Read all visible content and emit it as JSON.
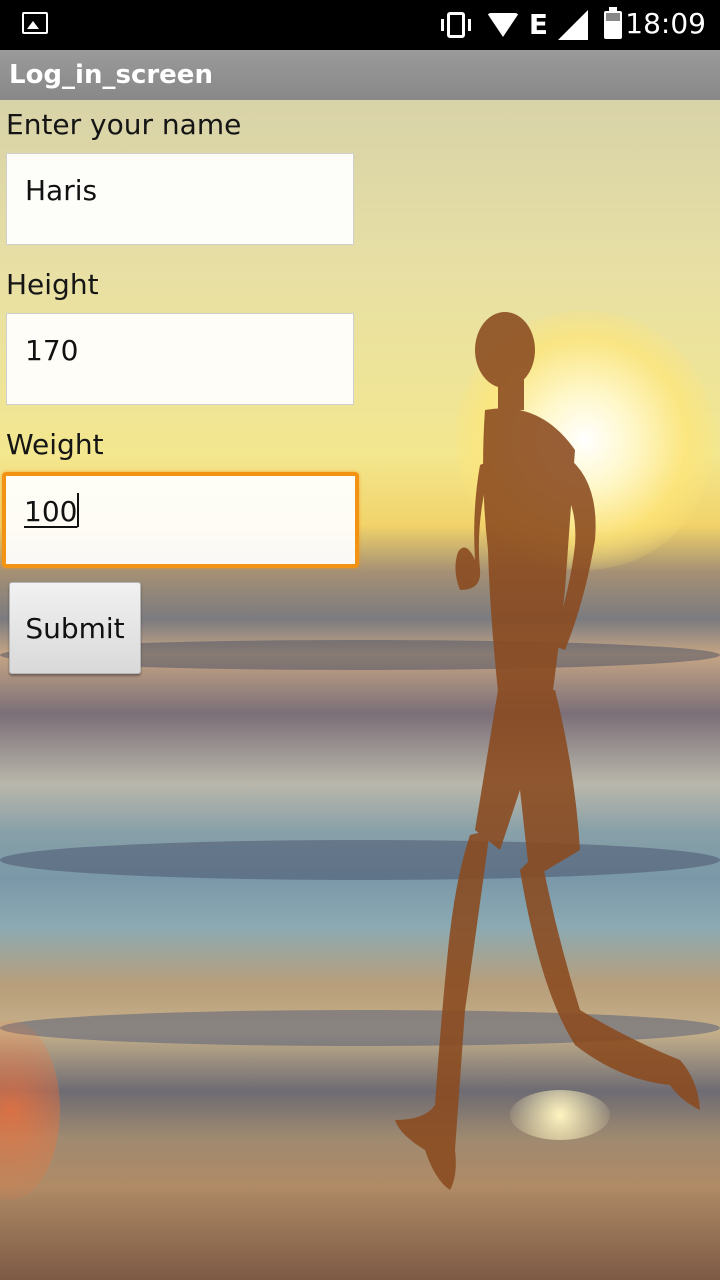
{
  "status_bar": {
    "time": "18:09",
    "network_type": "E",
    "icons": [
      "image-icon",
      "vibrate-icon",
      "wifi-icon",
      "signal-icon",
      "battery-icon"
    ]
  },
  "app_bar": {
    "title": "Log_in_screen"
  },
  "form": {
    "name_label": "Enter your name",
    "name_value": "Haris",
    "height_label": "Height",
    "height_value": "170",
    "weight_label": "Weight",
    "weight_value": "100",
    "submit_label": "Submit"
  },
  "colors": {
    "focus_border": "#f39314",
    "app_bar": "#8f8f8f",
    "status_bar": "#000000"
  }
}
